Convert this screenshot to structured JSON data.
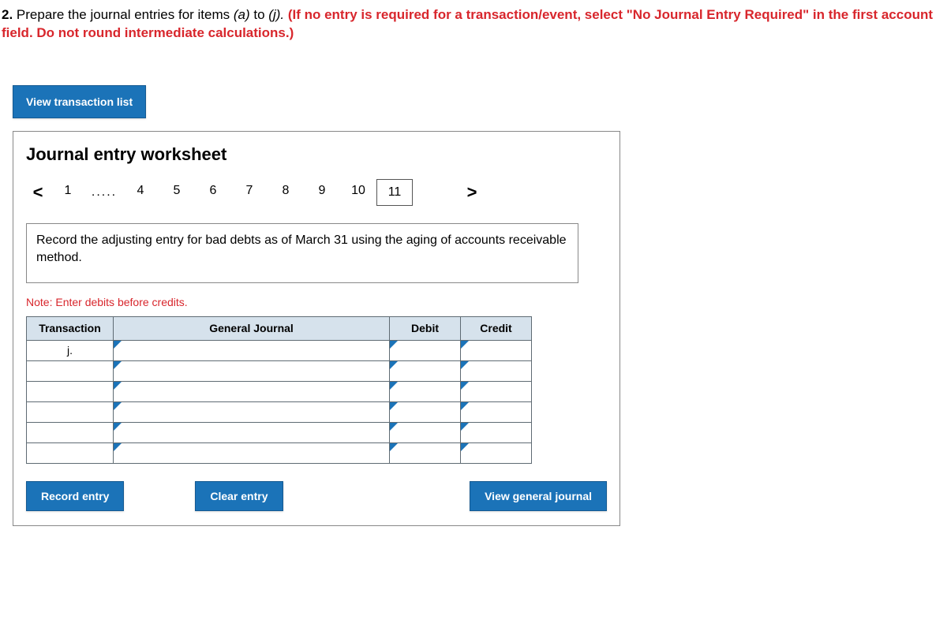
{
  "instruction": {
    "qnum": "2.",
    "lead": " Prepare the journal entries for items ",
    "range_a": "(a)",
    "mid": " to ",
    "range_j": "(j).",
    "red": " (If no entry is required for a transaction/event, select \"No Journal Entry Required\" in the first account field. Do not round intermediate calculations.)"
  },
  "buttons": {
    "view_transaction_list": "View transaction list",
    "record_entry": "Record entry",
    "clear_entry": "Clear entry",
    "view_general_journal": "View general journal"
  },
  "worksheet": {
    "title": "Journal entry worksheet",
    "nav": {
      "prev": "<",
      "next": ">",
      "pages": [
        "1",
        ".....",
        "4",
        "5",
        "6",
        "7",
        "8",
        "9",
        "10",
        "11"
      ],
      "active_index": 9
    },
    "description": "Record the adjusting entry for bad debts as of March 31 using the aging of accounts receivable method.",
    "note": "Note: Enter debits before credits.",
    "table": {
      "headers": {
        "transaction": "Transaction",
        "general_journal": "General Journal",
        "debit": "Debit",
        "credit": "Credit"
      },
      "first_row_transaction": "j.",
      "row_count": 6
    }
  }
}
